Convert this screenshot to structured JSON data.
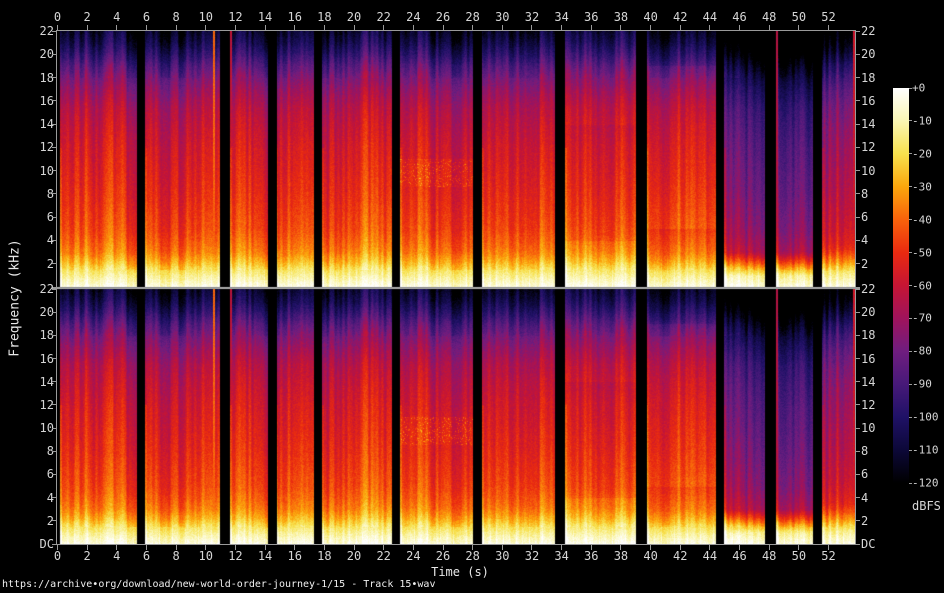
{
  "figure": {
    "url_caption": "https://archive•org/download/new-world-order-journey-1/15 - Track 15•wav",
    "background": "#000000",
    "text_color": "#d6d6d6",
    "axis_color": "#9a9a9a"
  },
  "chart_data": {
    "type": "heatmap",
    "subtype": "audio-spectrogram",
    "channels": 2,
    "xlabel": "Time (s)",
    "ylabel": "Frequency (kHz)",
    "x_range_s": [
      0,
      53.8
    ],
    "y_range_khz": [
      0,
      22
    ],
    "x_ticks": [
      "0",
      "2",
      "4",
      "6",
      "8",
      "10",
      "12",
      "14",
      "16",
      "18",
      "20",
      "22",
      "24",
      "26",
      "28",
      "30",
      "32",
      "34",
      "36",
      "38",
      "40",
      "42",
      "44",
      "46",
      "48",
      "50",
      "52"
    ],
    "y_ticks_channel1": [
      "22",
      "20",
      "18",
      "16",
      "14",
      "12",
      "10",
      "8",
      "6",
      "4",
      "2"
    ],
    "y_ticks_channel2": [
      "22",
      "20",
      "18",
      "16",
      "14",
      "12",
      "10",
      "8",
      "6",
      "4",
      "2",
      "DC"
    ],
    "colorbar": {
      "label": "dBFS",
      "ticks": [
        "+0",
        "-10",
        "-20",
        "-30",
        "-40",
        "-50",
        "-60",
        "-70",
        "-80",
        "-90",
        "-100",
        "-110",
        "-120"
      ],
      "range_db": [
        0,
        -120
      ],
      "stops": [
        {
          "db": 0,
          "color": "#ffffff"
        },
        {
          "db": -10,
          "color": "#faf6b4"
        },
        {
          "db": -20,
          "color": "#f7e14d"
        },
        {
          "db": -30,
          "color": "#fba60c"
        },
        {
          "db": -40,
          "color": "#f8620b"
        },
        {
          "db": -50,
          "color": "#e92a10"
        },
        {
          "db": -60,
          "color": "#c61534"
        },
        {
          "db": -70,
          "color": "#9f135c"
        },
        {
          "db": -80,
          "color": "#6f1d7f"
        },
        {
          "db": -90,
          "color": "#471979"
        },
        {
          "db": -100,
          "color": "#1f1166"
        },
        {
          "db": -110,
          "color": "#0c0838"
        },
        {
          "db": -120,
          "color": "#000000"
        }
      ]
    },
    "level_vs_freq_db": [
      [
        0,
        -3
      ],
      [
        0.4,
        -7
      ],
      [
        1,
        -13
      ],
      [
        1.6,
        -19
      ],
      [
        2.2,
        -27
      ],
      [
        3,
        -35
      ],
      [
        4,
        -40
      ],
      [
        5,
        -44
      ],
      [
        6.5,
        -47
      ],
      [
        8,
        -50
      ],
      [
        10,
        -53
      ],
      [
        12,
        -56
      ],
      [
        14,
        -60
      ],
      [
        15.5,
        -64
      ],
      [
        17,
        -71
      ],
      [
        18,
        -77
      ],
      [
        19,
        -85
      ],
      [
        20,
        -95
      ],
      [
        21,
        -104
      ],
      [
        22,
        -111
      ]
    ],
    "segments": [
      {
        "start": 0.12,
        "end": 5.35,
        "character": "loud"
      },
      {
        "start": 5.85,
        "end": 10.9,
        "character": "loud"
      },
      {
        "start": 11.6,
        "end": 14.15,
        "character": "loud"
      },
      {
        "start": 14.75,
        "end": 17.25,
        "character": "loud"
      },
      {
        "start": 17.8,
        "end": 22.55,
        "character": "loud"
      },
      {
        "start": 23.05,
        "end": 28.0,
        "character": "loud",
        "speckle_band_khz": [
          8.6,
          11.0
        ]
      },
      {
        "start": 28.6,
        "end": 33.5,
        "character": "loud"
      },
      {
        "start": 34.2,
        "end": 39.0,
        "character": "darker_mids"
      },
      {
        "start": 39.7,
        "end": 44.4,
        "character": "brighter"
      },
      {
        "start": 44.95,
        "end": 47.7,
        "character": "quiet"
      },
      {
        "start": 48.45,
        "end": 50.95,
        "character": "quiet"
      },
      {
        "start": 51.55,
        "end": 53.8,
        "character": "medium"
      }
    ],
    "transients": [
      {
        "t": 10.55,
        "peak_db": -40
      },
      {
        "t": 11.7,
        "peak_db": -62
      },
      {
        "t": 48.5,
        "peak_db": -64
      },
      {
        "t": 53.68,
        "peak_db": -58
      }
    ]
  }
}
